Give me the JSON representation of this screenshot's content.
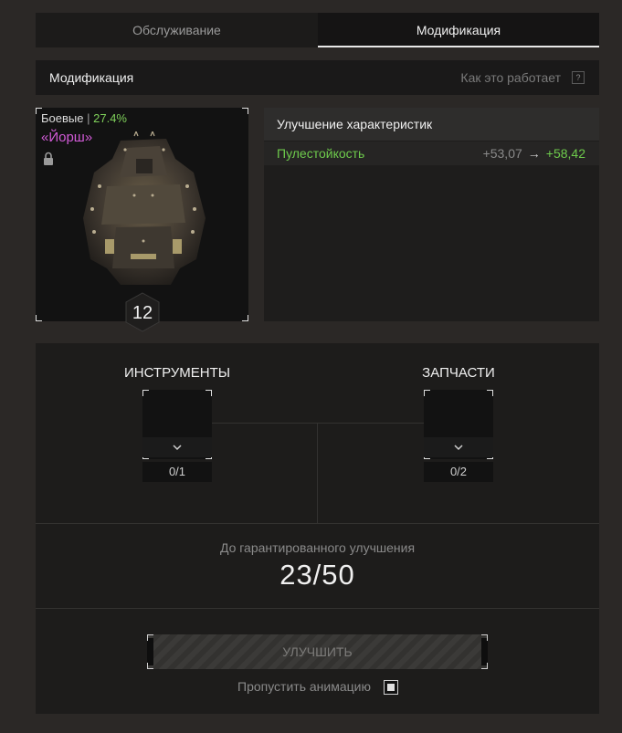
{
  "tabs": [
    {
      "label": "Обслуживание",
      "active": false
    },
    {
      "label": "Модификация",
      "active": true
    }
  ],
  "section": {
    "title": "Модификация",
    "how_it_works": "Как это работает",
    "help": "?"
  },
  "item": {
    "category": "Боевые",
    "separator": "|",
    "percent": "27.4%",
    "name": "«Йорш»",
    "level": "12",
    "locked": true,
    "colors": {
      "name": "#d25bd8",
      "percent": "#7fd05a"
    }
  },
  "stats": {
    "title": "Улучшение характеристик",
    "rows": [
      {
        "name": "Пулестойкость",
        "old": "+53,07",
        "arrow": "→",
        "new": "+58,42"
      }
    ]
  },
  "slots": {
    "tools": {
      "title": "ИНСТРУМЕНТЫ",
      "count": "0/1",
      "icon": "chevron-down-icon"
    },
    "parts": {
      "title": "ЗАПЧАСТИ",
      "count": "0/2",
      "icon": "chevron-down-icon"
    }
  },
  "guarantee": {
    "label": "До гарантированного улучшения",
    "value": "23/50",
    "current": 23,
    "total": 50
  },
  "upgrade_button": {
    "label": "УЛУЧШИТЬ",
    "enabled": false
  },
  "skip_animation": {
    "label": "Пропустить анимацию",
    "checked": true
  }
}
